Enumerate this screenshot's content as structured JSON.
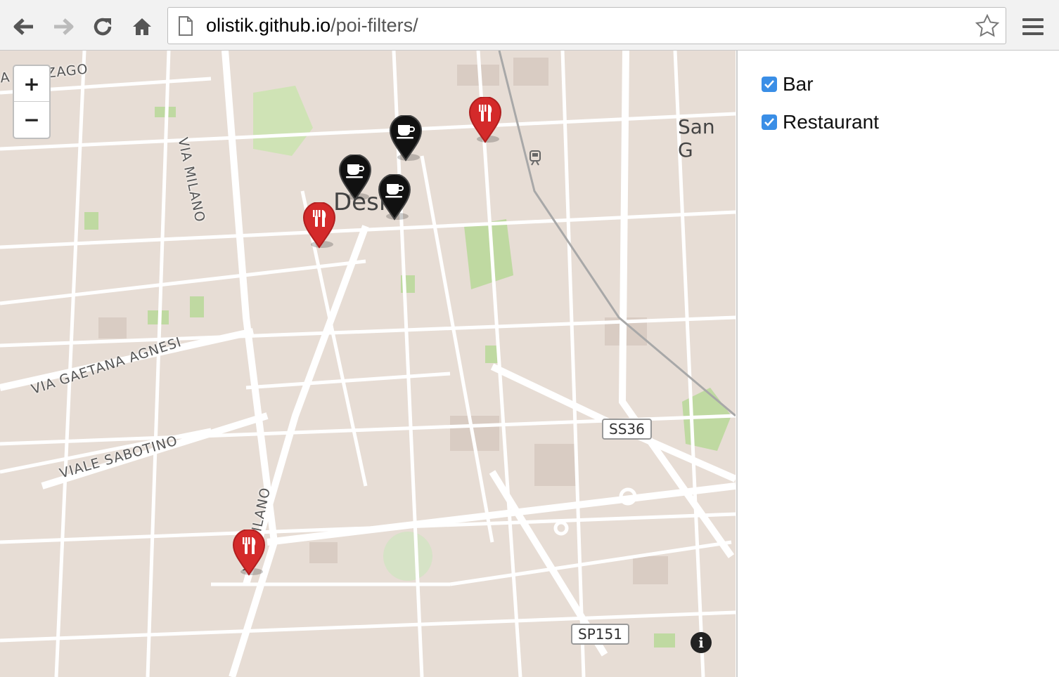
{
  "browser": {
    "url_host": "olistik.github.io",
    "url_path": "/poi-filters/"
  },
  "map": {
    "zoom_in_label": "+",
    "zoom_out_label": "−",
    "info_label": "i",
    "labels": {
      "nzago": "A RONZAGO",
      "via_milano_top": "VIA MILANO",
      "via_milano_bottom": "VIA MILANO",
      "via_agnesi": "VIA GAETANA AGNESI",
      "viale_sabotino": "VIALE SABOTINO",
      "town": "Desio",
      "san_g": "San G"
    },
    "shields": {
      "ss36": "SS36",
      "sp151": "SP151"
    },
    "markers": [
      {
        "type": "restaurant",
        "icon": "utensils-icon"
      },
      {
        "type": "restaurant",
        "icon": "utensils-icon"
      },
      {
        "type": "restaurant",
        "icon": "utensils-icon"
      },
      {
        "type": "bar",
        "icon": "coffee-cup-icon"
      },
      {
        "type": "bar",
        "icon": "coffee-cup-icon"
      },
      {
        "type": "bar",
        "icon": "coffee-cup-icon"
      }
    ]
  },
  "filters": [
    {
      "label": "Bar",
      "checked": true
    },
    {
      "label": "Restaurant",
      "checked": true
    }
  ],
  "colors": {
    "restaurant": "#d42a2a",
    "bar": "#111111",
    "checkbox": "#3a8ee6"
  }
}
